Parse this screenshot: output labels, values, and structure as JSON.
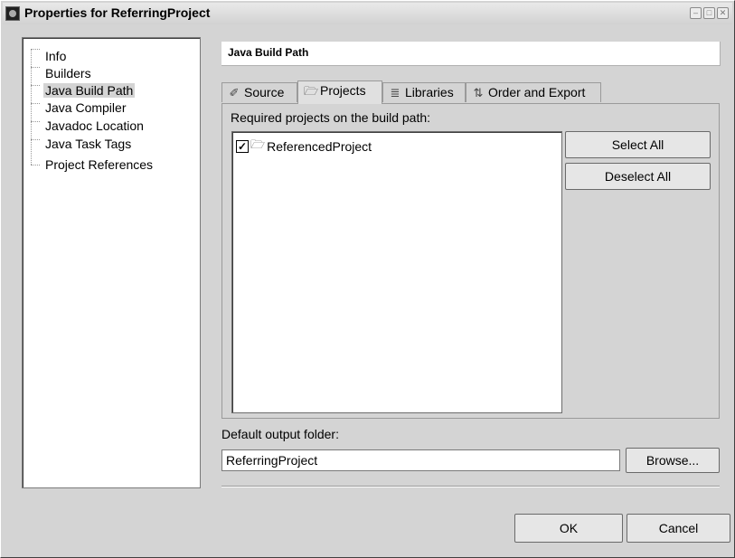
{
  "window": {
    "title": "Properties for ReferringProject"
  },
  "nav": {
    "items": [
      {
        "label": "Info"
      },
      {
        "label": "Builders"
      },
      {
        "label": "Java Build Path"
      },
      {
        "label": "Java Compiler"
      },
      {
        "label": "Javadoc Location"
      },
      {
        "label": "Java Task Tags"
      },
      {
        "label": "Project References"
      }
    ],
    "selected": "Java Build Path"
  },
  "page": {
    "title": "Java Build Path",
    "tabs": [
      {
        "label": "Source",
        "icon": "source-icon"
      },
      {
        "label": "Projects",
        "icon": "projects-icon"
      },
      {
        "label": "Libraries",
        "icon": "libraries-icon"
      },
      {
        "label": "Order and Export",
        "icon": "order-export-icon"
      }
    ],
    "active_tab": "Projects",
    "required_label": "Required projects on the build path:",
    "projects": [
      {
        "name": "ReferencedProject",
        "checked": true
      }
    ],
    "select_all_label": "Select All",
    "deselect_all_label": "Deselect All",
    "output_label": "Default output folder:",
    "output_value": "ReferringProject",
    "browse_label": "Browse..."
  },
  "buttons": {
    "ok": "OK",
    "cancel": "Cancel"
  }
}
